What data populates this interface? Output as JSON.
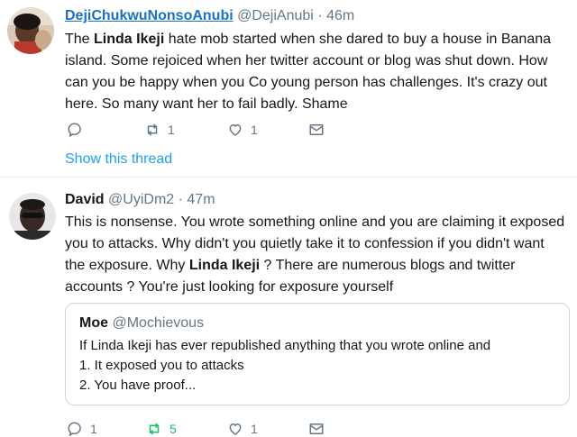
{
  "tweets": [
    {
      "display_name": "DejiChukwuNonsoAnubi",
      "handle": "@DejiAnubi",
      "separator": "·",
      "time": "46m",
      "text_1": "The ",
      "text_bold": "Linda Ikeji",
      "text_2": " hate mob started when she dared to buy a house in Banana island.  Some rejoiced when her twitter account or blog was shut down.  How can you be happy when you Co young person has challenges.  It's crazy out here. So many want her to fail badly. Shame",
      "reply_count": "",
      "retweet_count": "1",
      "like_count": "1",
      "show_thread": "Show this thread"
    },
    {
      "display_name": "David",
      "handle": "@UyiDm2",
      "separator": "·",
      "time": "47m",
      "text_1": "This is nonsense. You wrote something online and you are claiming it exposed you to attacks. Why didn't you quietly take it to confession if you didn't want the exposure. Why ",
      "text_bold": "Linda Ikeji",
      "text_2": " ? There are numerous blogs  and twitter accounts ? You're just looking for exposure yourself",
      "reply_count": "1",
      "retweet_count": "5",
      "like_count": "1",
      "quote": {
        "display_name": "Moe",
        "handle": "@Mochievous",
        "line_1": "If Linda Ikeji has ever republished anything that you wrote online and",
        "line_2": "1. It exposed you to attacks",
        "line_3": "2. You have proof..."
      }
    }
  ],
  "icons": {
    "reply": "reply-icon",
    "retweet": "retweet-icon",
    "like": "like-icon",
    "dm": "direct-message-icon"
  },
  "colors": {
    "link_blue": "#1da1f2",
    "name_link": "#1b72c0",
    "muted": "#657786",
    "retweet_green": "#17bf63"
  }
}
